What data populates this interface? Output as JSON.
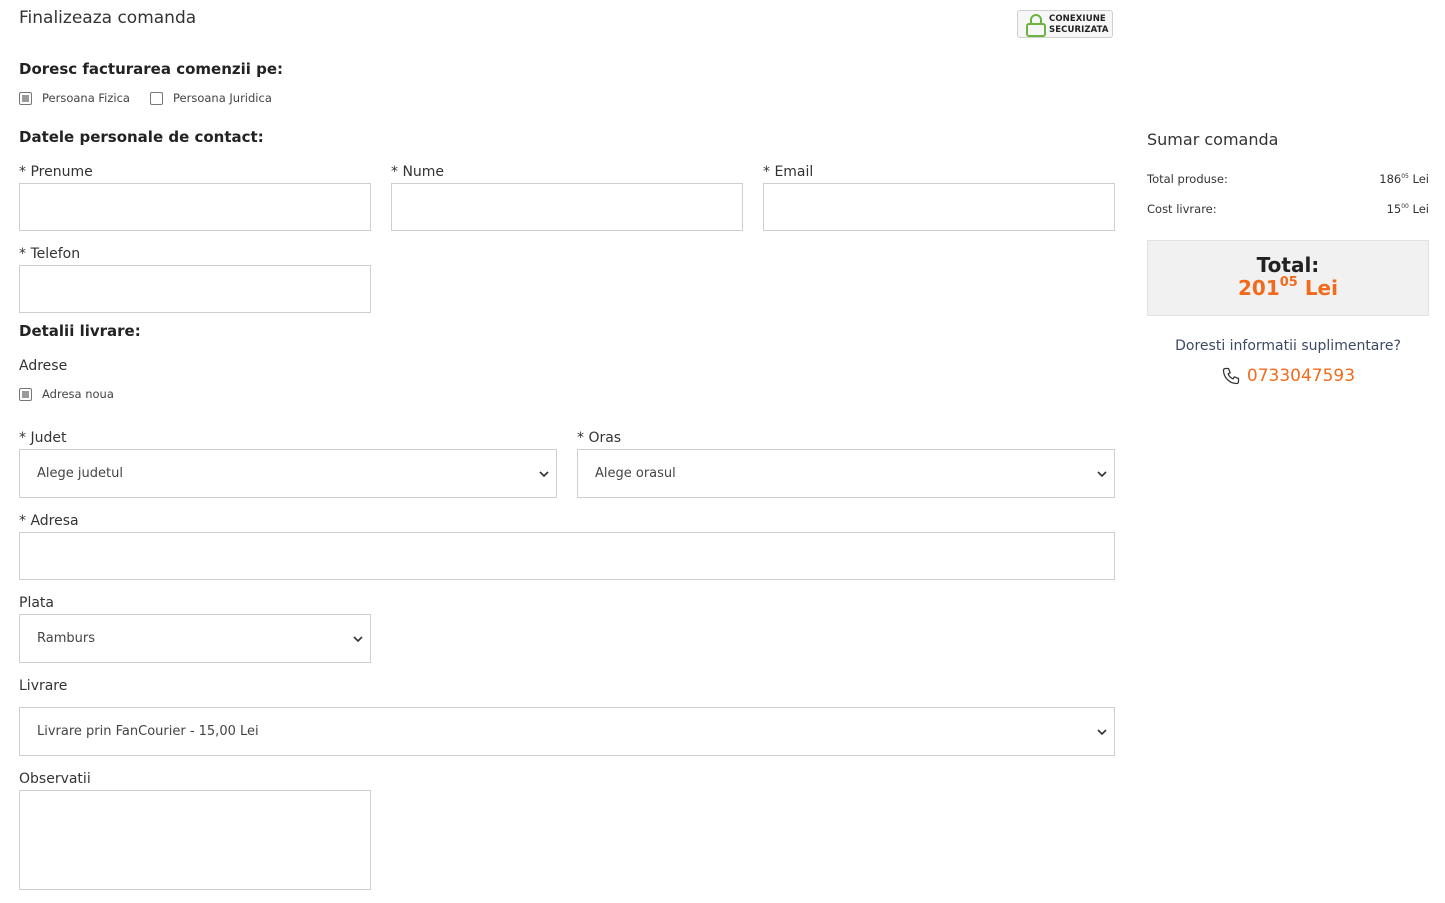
{
  "header": {
    "title": "Finalizeaza comanda",
    "secure_line1": "CONEXIUNE",
    "secure_line2": "SECURIZATA"
  },
  "billing": {
    "heading": "Doresc facturarea comenzii pe:",
    "options": [
      {
        "label": "Persoana Fizica",
        "checked": true
      },
      {
        "label": "Persoana Juridica",
        "checked": false
      }
    ]
  },
  "contact": {
    "heading": "Datele personale de contact:",
    "firstname_label": "* Prenume",
    "lastname_label": "* Nume",
    "email_label": "* Email",
    "phone_label": "* Telefon"
  },
  "delivery": {
    "heading": "Detalii livrare:",
    "addresses_label": "Adrese",
    "new_address_label": "Adresa noua",
    "county_label": "* Judet",
    "county_value": "Alege judetul",
    "city_label": "* Oras",
    "city_value": "Alege orasul",
    "address_label": "* Adresa"
  },
  "payment": {
    "label": "Plata",
    "value": "Ramburs"
  },
  "shipping": {
    "label": "Livrare",
    "value": "Livrare prin FanCourier - 15,00 Lei"
  },
  "notes": {
    "label": "Observatii"
  },
  "summary": {
    "title": "Sumar comanda",
    "products_label": "Total produse:",
    "products_int": "186",
    "products_dec": "05",
    "products_cur": "Lei",
    "shipping_label": "Cost livrare:",
    "shipping_int": "15",
    "shipping_dec": "00",
    "shipping_cur": "Lei",
    "total_label": "Total:",
    "total_int": "201",
    "total_dec": "05",
    "total_cur": "Lei",
    "info_text": "Doresti informatii suplimentare?",
    "phone": "0733047593"
  },
  "colors": {
    "accent": "#f26b1d",
    "secure_green": "#6cb33f",
    "info_text": "#3b4a63"
  }
}
